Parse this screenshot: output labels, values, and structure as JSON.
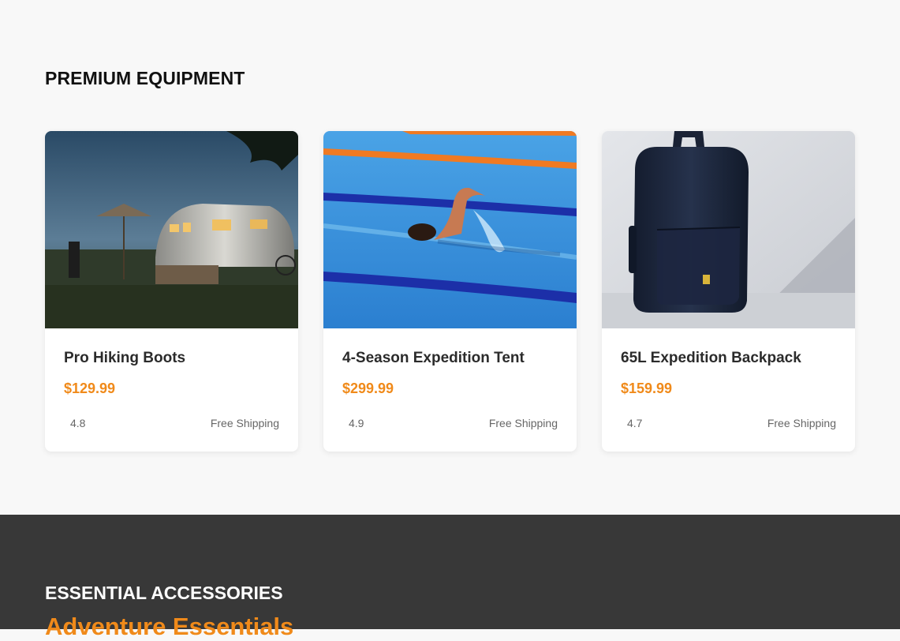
{
  "premium": {
    "title": "PREMIUM EQUIPMENT",
    "products": [
      {
        "image": "camper-trailer-dusk-photo",
        "name": "Pro Hiking Boots",
        "price": "$129.99",
        "rating": "4.8",
        "shipping": "Free Shipping"
      },
      {
        "image": "swimmer-in-pool-photo",
        "name": "4-Season Expedition Tent",
        "price": "$299.99",
        "rating": "4.9",
        "shipping": "Free Shipping"
      },
      {
        "image": "navy-backpack-photo",
        "name": "65L Expedition Backpack",
        "price": "$159.99",
        "rating": "4.7",
        "shipping": "Free Shipping"
      }
    ]
  },
  "accessories": {
    "title": "ESSENTIAL ACCESSORIES",
    "subtitle": "Adventure Essentials"
  },
  "colors": {
    "accent": "#f08a1a",
    "dark_section": "#383838",
    "page_bg": "#f8f8f8"
  }
}
